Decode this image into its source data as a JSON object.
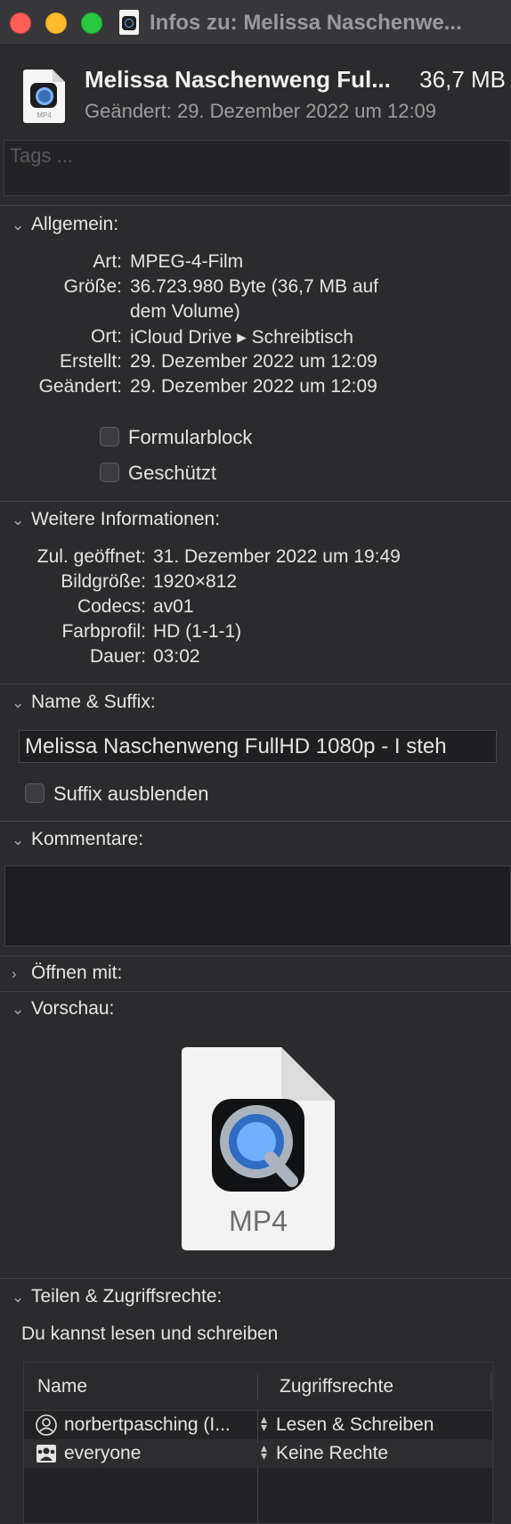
{
  "window": {
    "title": "Infos zu: Melissa Naschenwe..."
  },
  "header": {
    "file_name": "Melissa Naschenweng Ful...",
    "file_size": "36,7 MB",
    "modified": "Geändert: 29. Dezember 2022 um 12:09",
    "icon_label": "MP4"
  },
  "tags": {
    "placeholder": "Tags ..."
  },
  "general": {
    "title": "Allgemein:",
    "rows": [
      {
        "key": "Art:",
        "value": "MPEG-4-Film"
      },
      {
        "key": "Größe:",
        "value": "36.723.980 Byte (36,7 MB auf"
      },
      {
        "key": "",
        "value": "dem Volume)"
      },
      {
        "key": "Ort:",
        "value": "iCloud Drive ▸ Schreibtisch"
      },
      {
        "key": "Erstellt:",
        "value": "29. Dezember 2022 um 12:09"
      },
      {
        "key": "Geändert:",
        "value": "29. Dezember 2022 um 12:09"
      }
    ],
    "stationery_label": "Formularblock",
    "locked_label": "Geschützt"
  },
  "more_info": {
    "title": "Weitere Informationen:",
    "rows": [
      {
        "key": "Zul. geöffnet:",
        "value": "31. Dezember 2022 um 19:49"
      },
      {
        "key": "Bildgröße:",
        "value": "1920×812"
      },
      {
        "key": "Codecs:",
        "value": "av01"
      },
      {
        "key": "Farbprofil:",
        "value": "HD (1-1-1)"
      },
      {
        "key": "Dauer:",
        "value": "03:02"
      }
    ]
  },
  "name_suffix": {
    "title": "Name & Suffix:",
    "value": "Melissa Naschenweng FullHD 1080p - I steh",
    "hide_extension_label": "Suffix ausblenden"
  },
  "comments": {
    "title": "Kommentare:"
  },
  "open_with": {
    "title": "Öffnen mit:"
  },
  "preview": {
    "title": "Vorschau:",
    "label": "MP4"
  },
  "sharing": {
    "title": "Teilen & Zugriffsrechte:",
    "summary": "Du kannst lesen und schreiben",
    "col_name": "Name",
    "col_rights": "Zugriffsrechte",
    "rows": [
      {
        "name": "norbertpasching (I...",
        "rights": "Lesen & Schreiben"
      },
      {
        "name": "everyone",
        "rights": "Keine Rechte"
      }
    ]
  }
}
